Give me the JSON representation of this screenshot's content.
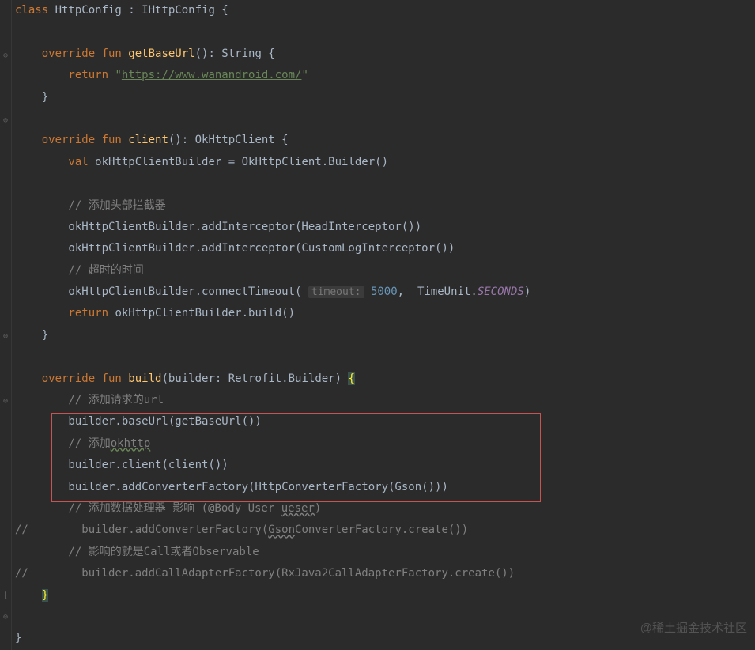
{
  "gutter": [
    "",
    "",
    "⊖",
    "",
    "",
    "⊖",
    "",
    "",
    "",
    "",
    "",
    "",
    "",
    "",
    "",
    "⊖",
    "",
    "",
    "⊖",
    "",
    "",
    "",
    "",
    "",
    "",
    "",
    "",
    "⌊",
    "⊖",
    ""
  ],
  "code": {
    "l1": {
      "a": "class ",
      "b": "HttpConfig : IHttpConfig {"
    },
    "l3": {
      "a": "    override fun ",
      "b": "getBaseUrl",
      "c": "(): String {"
    },
    "l4": {
      "a": "        return ",
      "b": "\"",
      "c": "https://www.wanandroid.com/",
      "d": "\""
    },
    "l5": {
      "a": "    }"
    },
    "l7": {
      "a": "    override fun ",
      "b": "client",
      "c": "(): OkHttpClient {"
    },
    "l8": {
      "a": "        val ",
      "b": "okHttpClientBuilder = OkHttpClient.Builder()"
    },
    "l10": {
      "a": "        // 添加头部拦截器"
    },
    "l11": {
      "a": "        okHttpClientBuilder.addInterceptor(HeadInterceptor())"
    },
    "l12": {
      "a": "        okHttpClientBuilder.addInterceptor(CustomLogInterceptor())"
    },
    "l13": {
      "a": "        // 超时的时间"
    },
    "l14": {
      "a": "        okHttpClientBuilder.connectTimeout( ",
      "hint": "timeout:",
      "sp": " ",
      "b": "5000",
      "c": ",  TimeUnit.",
      "d": "SECONDS",
      "e": ")"
    },
    "l15": {
      "a": "        return ",
      "b": "okHttpClientBuilder.build()"
    },
    "l16": {
      "a": "    }"
    },
    "l18": {
      "a": "    override fun ",
      "b": "build",
      "c": "(builder: Retrofit.Builder) ",
      "d": "{"
    },
    "l19": {
      "a": "        // 添加请求的url"
    },
    "l20": {
      "a": "        builder.baseUrl(getBaseUrl())"
    },
    "l21": {
      "a": "        // 添加",
      "b": "okhttp"
    },
    "l22": {
      "a": "        builder.client(client())"
    },
    "l23": {
      "a": "        builder.addConverterFactory(HttpConverterFactory(Gson()))"
    },
    "l24": {
      "a": "        // 添加数据处理器 影响 (@Body User ",
      "b": "ueser",
      "c": ")"
    },
    "l25": {
      "a": "//        builder.addConverterFactory(",
      "b": "Gson",
      "c": "ConverterFactory.create())"
    },
    "l26": {
      "a": "        // 影响的就是Call或者Observable"
    },
    "l27": {
      "a": "//        builder.addCallAdapterFactory(RxJava2CallAdapterFactory.create())"
    },
    "l28": {
      "a": "    ",
      "b": "}"
    },
    "l30": {
      "a": "}"
    }
  },
  "watermark": "@稀土掘金技术社区"
}
